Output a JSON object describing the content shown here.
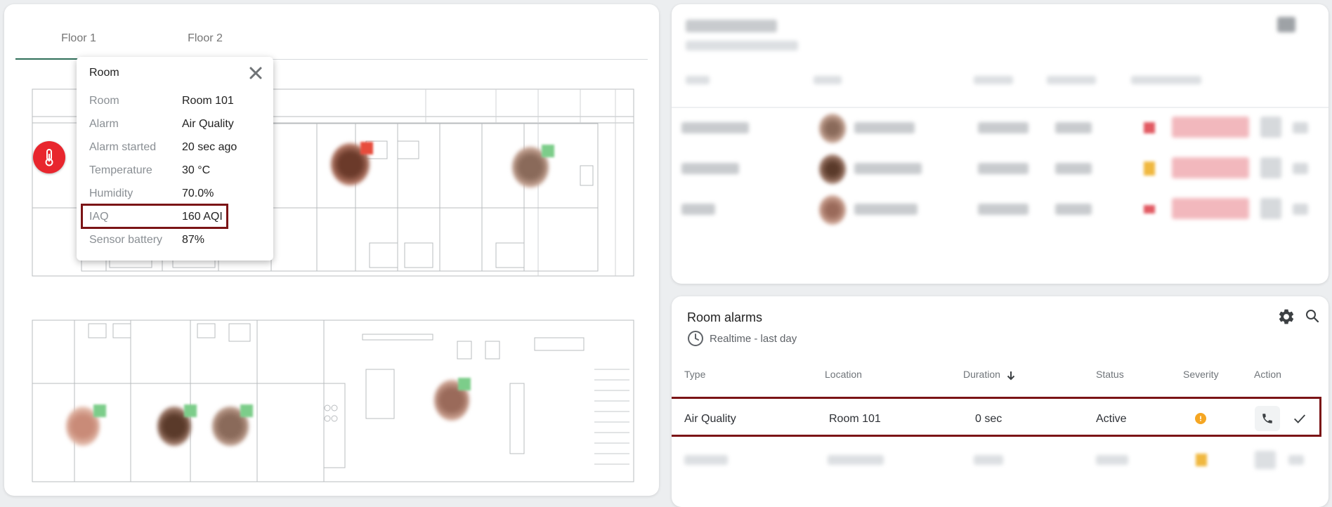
{
  "floor_panel": {
    "tabs": [
      {
        "label": "Floor 1",
        "selected": true
      },
      {
        "label": "Floor 2",
        "selected": false
      }
    ],
    "popup": {
      "title": "Room",
      "rows": [
        {
          "key": "Room",
          "value": "Room 101"
        },
        {
          "key": "Alarm",
          "value": "Air Quality"
        },
        {
          "key": "Alarm started",
          "value": "20 sec ago"
        },
        {
          "key": "Temperature",
          "value": "30 °C"
        },
        {
          "key": "Humidity",
          "value": "70.0%"
        },
        {
          "key": "IAQ",
          "value": "160 AQI"
        },
        {
          "key": "Sensor battery",
          "value": "87%"
        }
      ]
    },
    "marker_icon": "thermometer-icon"
  },
  "room_alarms": {
    "title": "Room alarms",
    "subtitle": "Realtime - last day",
    "columns": [
      "Type",
      "Location",
      "Duration",
      "Status",
      "Severity",
      "Action"
    ],
    "rows": [
      {
        "type": "Air Quality",
        "location": "Room 101",
        "duration": "0 sec",
        "status": "Active",
        "severity_color": "#f5a623"
      }
    ]
  },
  "colors": {
    "accent_tab": "#2f6f5a",
    "alarm_red": "#e8262e",
    "highlight": "#7b1416",
    "warning": "#f5a623"
  }
}
